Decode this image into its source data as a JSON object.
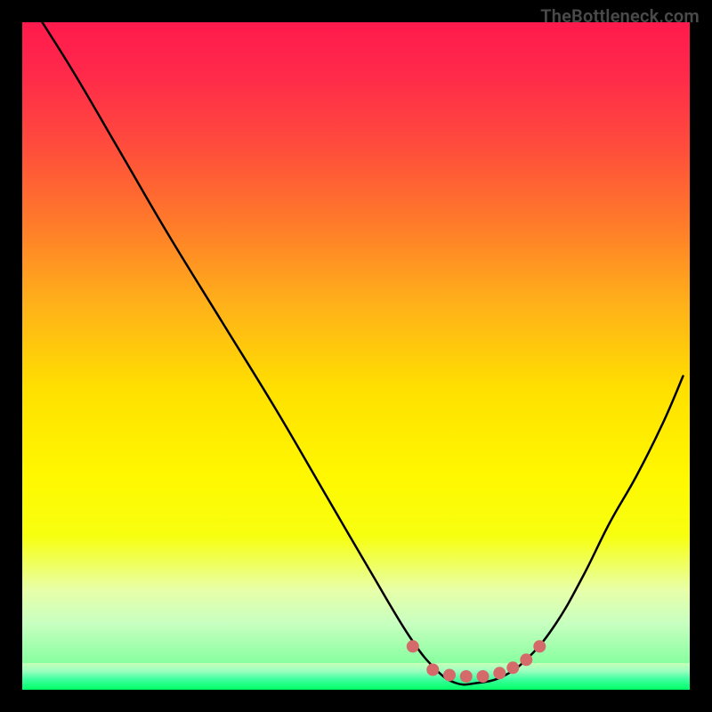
{
  "watermark": "TheBottleneck.com",
  "colors": {
    "background": "#000000",
    "curve": "#000000",
    "dots": "#d46a6a"
  },
  "chart_data": {
    "type": "line",
    "title": "",
    "xlabel": "",
    "ylabel": "",
    "xlim": [
      0,
      100
    ],
    "ylim": [
      0,
      100
    ],
    "series": [
      {
        "name": "bottleneck-curve",
        "x": [
          3,
          8,
          15,
          22,
          30,
          38,
          45,
          52,
          58,
          62,
          65,
          68,
          72,
          76,
          80,
          84,
          88,
          92,
          96,
          99
        ],
        "y": [
          100,
          92,
          80,
          68,
          55,
          42,
          30,
          18,
          8,
          3,
          1,
          1,
          2,
          5,
          10,
          17,
          25,
          32,
          40,
          47
        ]
      }
    ],
    "markers": [
      {
        "x": 58.5,
        "y": 6.5
      },
      {
        "x": 61.5,
        "y": 3.0
      },
      {
        "x": 64.0,
        "y": 2.2
      },
      {
        "x": 66.5,
        "y": 2.0
      },
      {
        "x": 69.0,
        "y": 2.0
      },
      {
        "x": 71.5,
        "y": 2.5
      },
      {
        "x": 73.5,
        "y": 3.3
      },
      {
        "x": 75.5,
        "y": 4.5
      },
      {
        "x": 77.5,
        "y": 6.5
      }
    ]
  }
}
